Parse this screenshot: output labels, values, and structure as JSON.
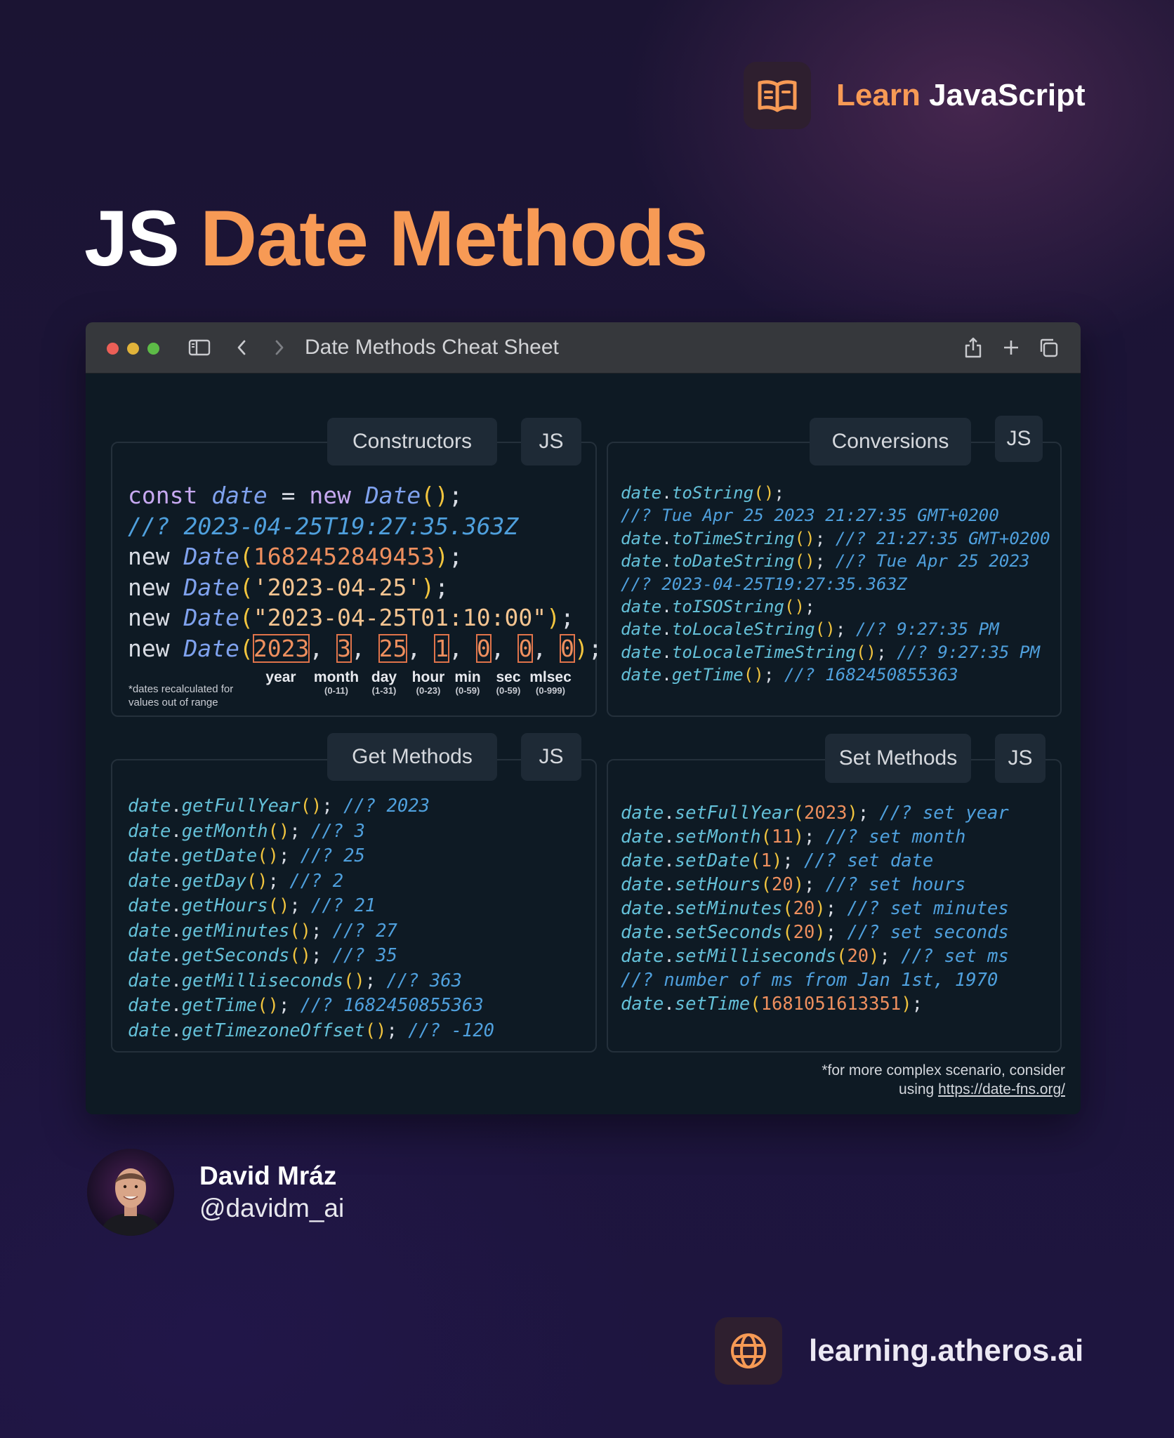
{
  "brand": {
    "word1": "Learn",
    "word2": "JavaScript",
    "icon": "book-icon",
    "accent": "#f79a55"
  },
  "title": {
    "part1": "JS",
    "part2": "Date Methods"
  },
  "window": {
    "title": "Date Methods Cheat Sheet"
  },
  "constructors": {
    "tag": "Constructors",
    "lang": "JS",
    "year": "year",
    "month": "month",
    "month_range": "(0-11)",
    "day": "day",
    "day_range": "(1-31)",
    "hour": "hour",
    "hour_range": "(0-23)",
    "min": "min",
    "min_range": "(0-59)",
    "sec": "sec",
    "sec_range": "(0-59)",
    "mlsec": "mlsec",
    "mlsec_range": "(0-999)",
    "note_line1": "*dates recalculated for",
    "note_line2": "values out of range"
  },
  "conversions": {
    "tag": "Conversions",
    "lang": "JS"
  },
  "get_methods": {
    "tag": "Get Methods",
    "lang": "JS"
  },
  "set_methods": {
    "tag": "Set Methods",
    "lang": "JS"
  },
  "footnote": {
    "line1": "*for more complex scenario, consider",
    "line2_prefix": "using ",
    "link": "https://date-fns.org/"
  },
  "author": {
    "name": "David Mráz",
    "handle": "@davidm_ai"
  },
  "site": {
    "url": "learning.atheros.ai",
    "icon": "globe-icon"
  }
}
